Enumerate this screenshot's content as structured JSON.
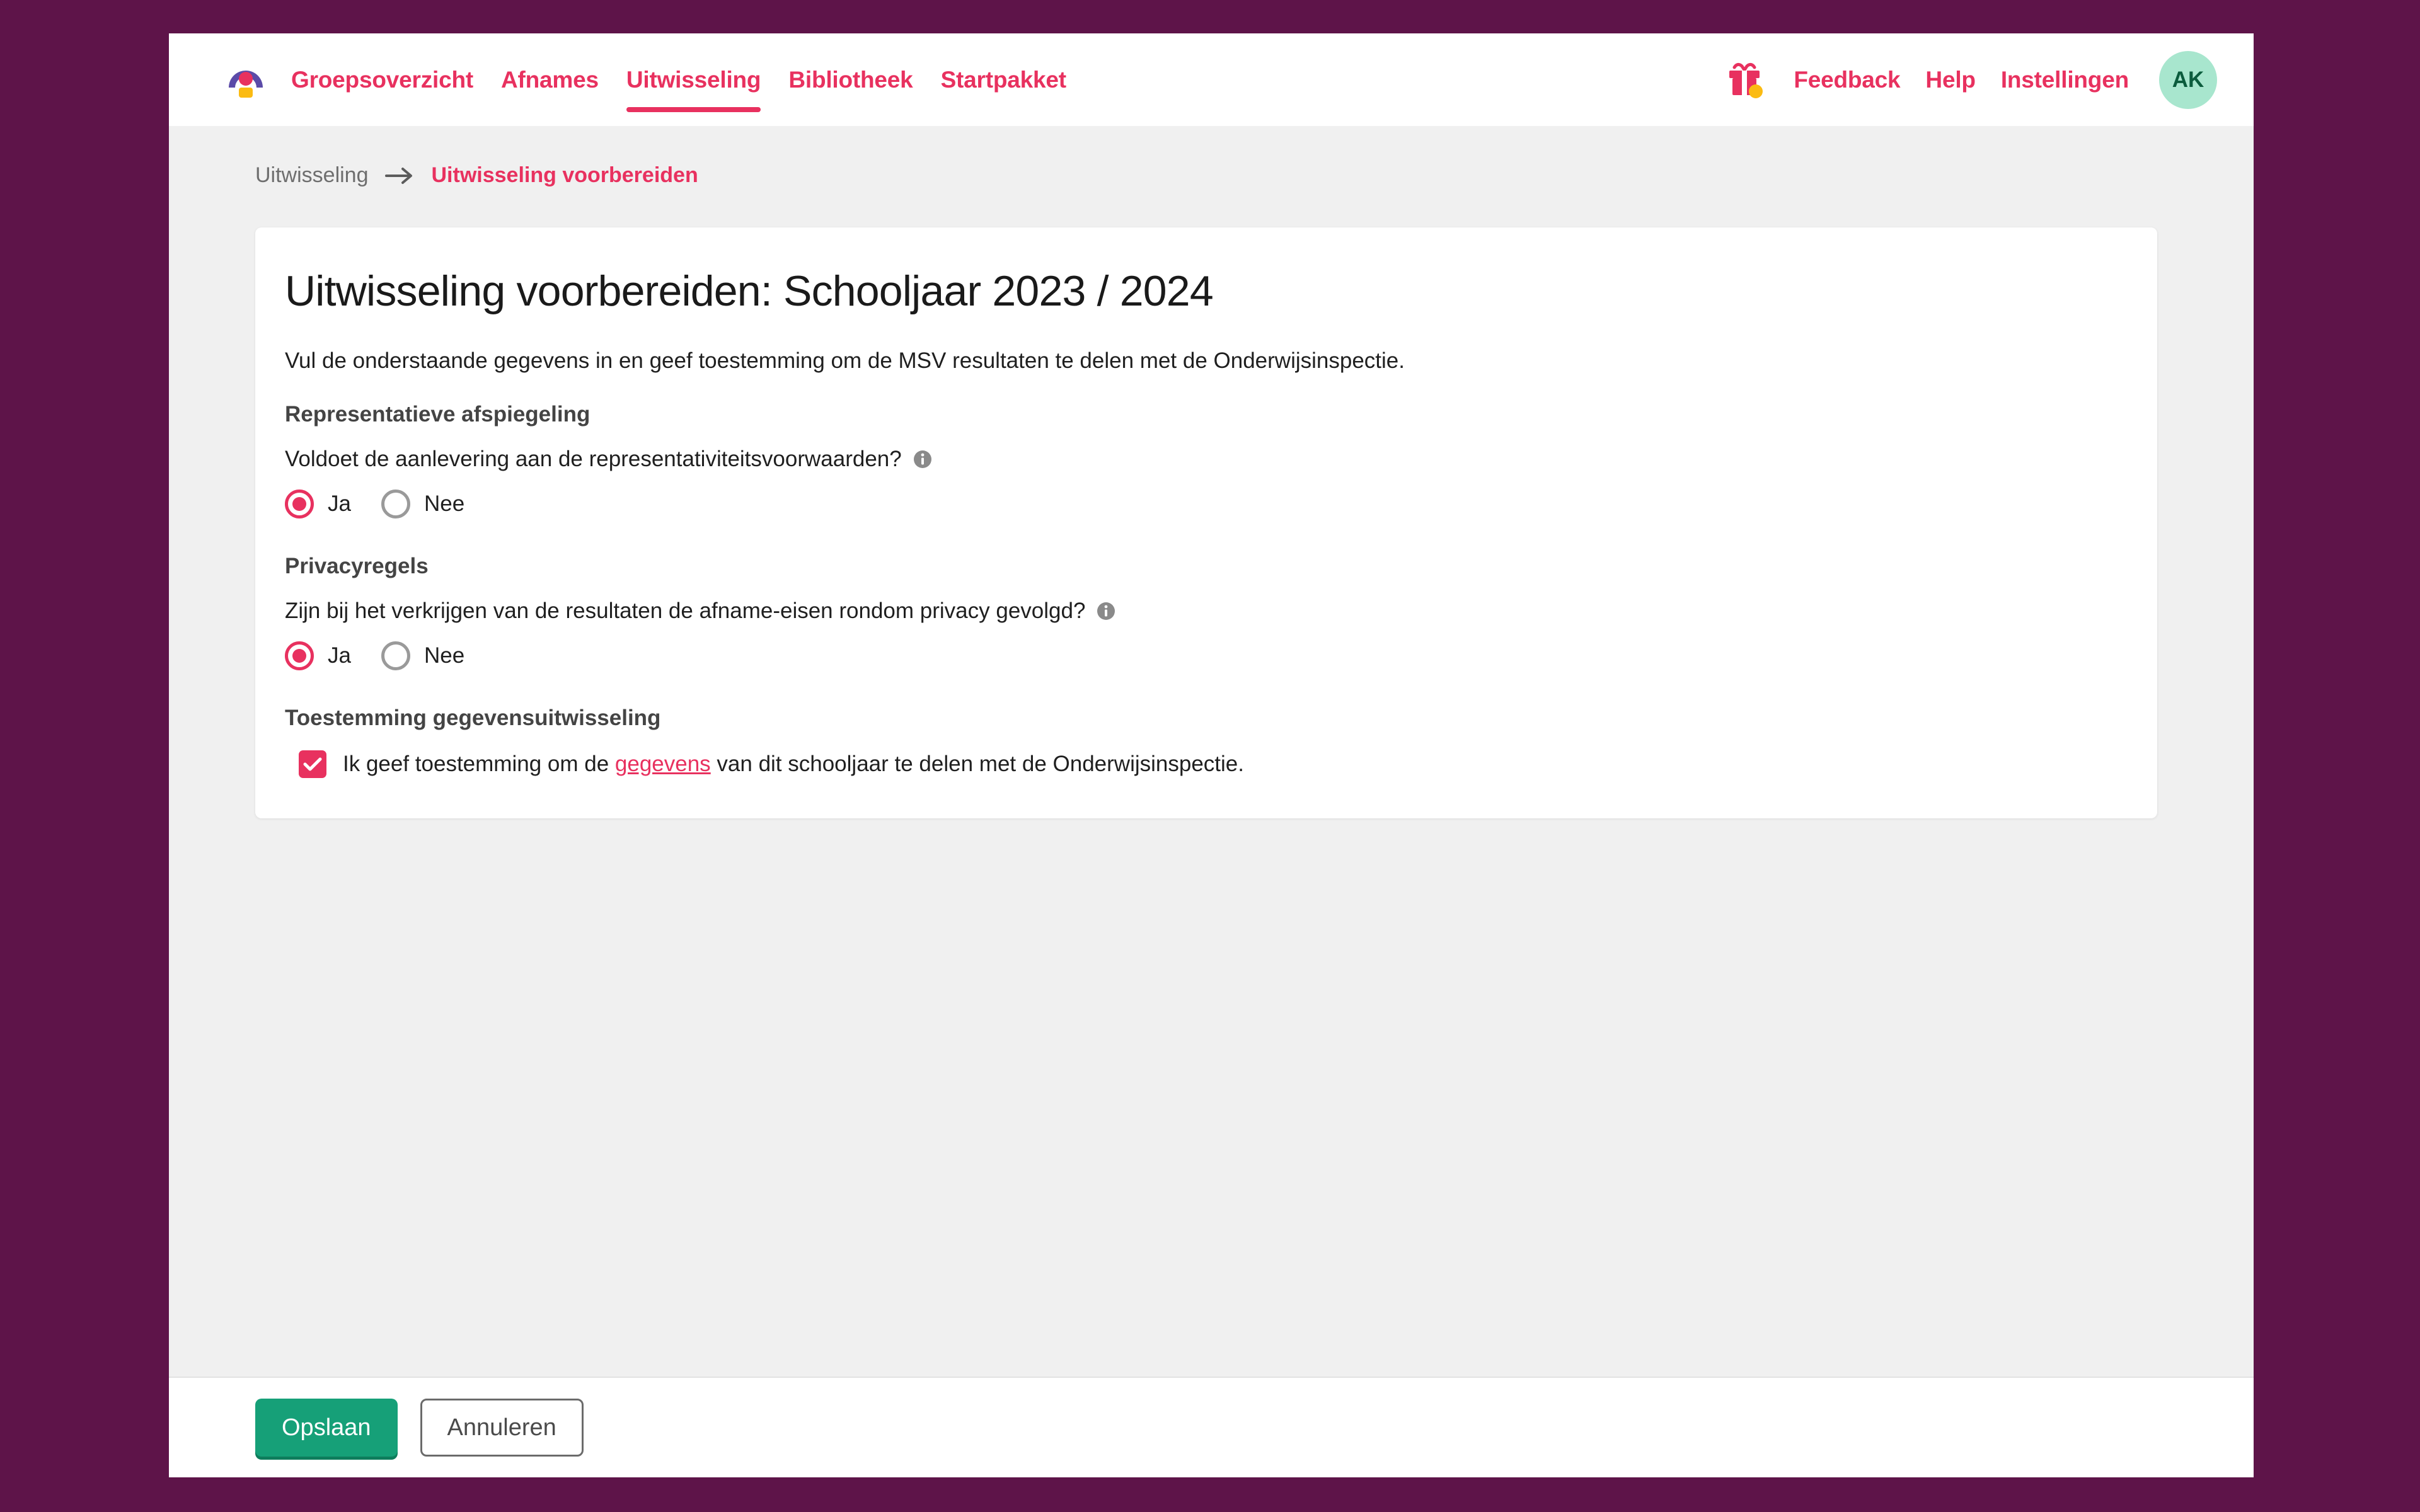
{
  "theme": {
    "page_background": "#5E1449",
    "content_background": "#F0F0F0",
    "accent_pink": "#E8315F",
    "primary_green": "#16A078",
    "avatar_background": "#A8E6CE",
    "avatar_text_color": "#0B5C3D",
    "logo_purple": "#5B4BA8",
    "logo_pink": "#E8315F",
    "logo_yellow": "#FBBB12"
  },
  "header": {
    "logo_name": "app-logo",
    "nav": [
      {
        "label": "Groepsoverzicht",
        "active": false
      },
      {
        "label": "Afnames",
        "active": false
      },
      {
        "label": "Uitwisseling",
        "active": true
      },
      {
        "label": "Bibliotheek",
        "active": false
      },
      {
        "label": "Startpakket",
        "active": false
      }
    ],
    "gift_icon": "gift-icon",
    "links": [
      {
        "label": "Feedback"
      },
      {
        "label": "Help"
      },
      {
        "label": "Instellingen"
      }
    ],
    "avatar_initials": "AK"
  },
  "breadcrumb": {
    "parent": "Uitwisseling",
    "arrow_icon": "arrow-right-icon",
    "current": "Uitwisseling voorbereiden"
  },
  "card": {
    "title": "Uitwisseling voorbereiden: Schooljaar 2023 / 2024",
    "intro": "Vul de onderstaande gegevens in en geef toestemming om de MSV resultaten te delen met de Onderwijsinspectie.",
    "sections": [
      {
        "heading": "Representatieve afspiegeling",
        "question": "Voldoet de aanlevering aan de representativiteitsvoorwaarden?",
        "info_icon": "info-icon",
        "options": [
          {
            "label": "Ja",
            "selected": true
          },
          {
            "label": "Nee",
            "selected": false
          }
        ]
      },
      {
        "heading": "Privacyregels",
        "question": "Zijn bij het verkrijgen van de resultaten de afname-eisen rondom privacy gevolgd?",
        "info_icon": "info-icon",
        "options": [
          {
            "label": "Ja",
            "selected": true
          },
          {
            "label": "Nee",
            "selected": false
          }
        ]
      }
    ],
    "consent": {
      "heading": "Toestemming gegevensuitwisseling",
      "checked": true,
      "check_icon": "check-icon",
      "text_before": "Ik geef toestemming om de ",
      "link_label": "gegevens",
      "text_after": " van dit schooljaar te delen met de Onderwijsinspectie."
    }
  },
  "footer": {
    "save_label": "Opslaan",
    "cancel_label": "Annuleren"
  }
}
